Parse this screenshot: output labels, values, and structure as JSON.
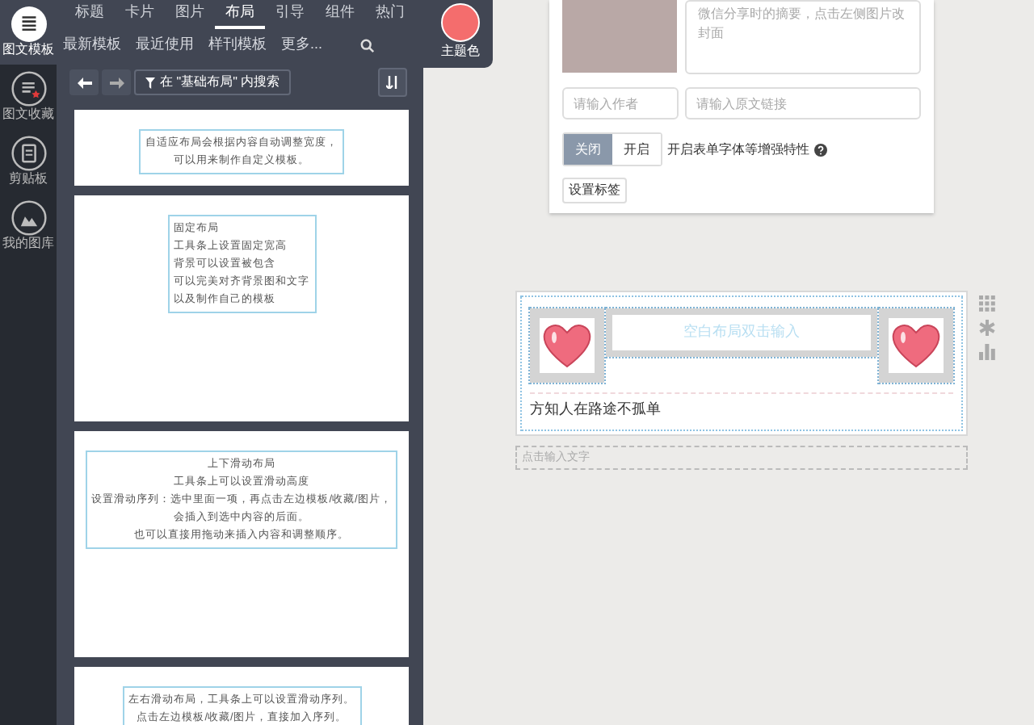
{
  "sidebar": {
    "items": [
      {
        "label": "图文模板",
        "selected": true,
        "kind": "lines"
      },
      {
        "label": "图文收藏",
        "selected": false,
        "kind": "star"
      },
      {
        "label": "剪贴板",
        "selected": false,
        "kind": "clipboard"
      },
      {
        "label": "我的图库",
        "selected": false,
        "kind": "image"
      }
    ]
  },
  "tabs": [
    {
      "label": "标题",
      "selected": false
    },
    {
      "label": "卡片",
      "selected": false
    },
    {
      "label": "图片",
      "selected": false
    },
    {
      "label": "布局",
      "selected": true
    },
    {
      "label": "引导",
      "selected": false
    },
    {
      "label": "组件",
      "selected": false
    },
    {
      "label": "热门",
      "selected": false
    }
  ],
  "subtabs": [
    {
      "label": "最新模板"
    },
    {
      "label": "最近使用"
    },
    {
      "label": "样刊模板"
    },
    {
      "label": "更多..."
    }
  ],
  "theme": {
    "label": "主题色",
    "color": "#f46d6d"
  },
  "toolbar": {
    "filter": "在 \"基础布局\" 内搜索"
  },
  "templates": [
    {
      "kind": "centered",
      "lines": [
        "自适应布局会根据内容自动调整宽度，",
        "可以用来制作自定义模板。"
      ]
    },
    {
      "kind": "plain",
      "lines": [
        "固定布局",
        "工具条上设置固定宽高",
        "背景可以设置被包含",
        "可以完美对齐背景图和文字",
        "以及制作自己的模板"
      ]
    },
    {
      "kind": "centered",
      "lines": [
        "上下滑动布局",
        "工具条上可以设置滑动高度",
        "设置滑动序列：选中里面一项，再点击左边模板/收藏/图片，",
        "会插入到选中内容的后面。",
        "也可以直接用拖动来插入内容和调整顺序。"
      ]
    },
    {
      "kind": "centered",
      "lines": [
        "左右滑动布局，工具条上可以设置滑动序列。",
        "点击左边模板/收藏/图片，直接加入序列。"
      ]
    }
  ],
  "article": {
    "summary_placeholder": "微信分享时的摘要，点击左侧图片改封面",
    "author_placeholder": "请输入作者",
    "link_placeholder": "请输入原文链接",
    "toggle": [
      {
        "label": "关闭",
        "selected": true
      },
      {
        "label": "开启",
        "selected": false
      }
    ],
    "toggle_label": "开启表单字体等增强特性",
    "tags_button": "设置标签"
  },
  "editor": {
    "blank_placeholder": "空白布局双击输入",
    "caption": "方知人在路途不孤单",
    "input_placeholder": "点击输入文字"
  }
}
